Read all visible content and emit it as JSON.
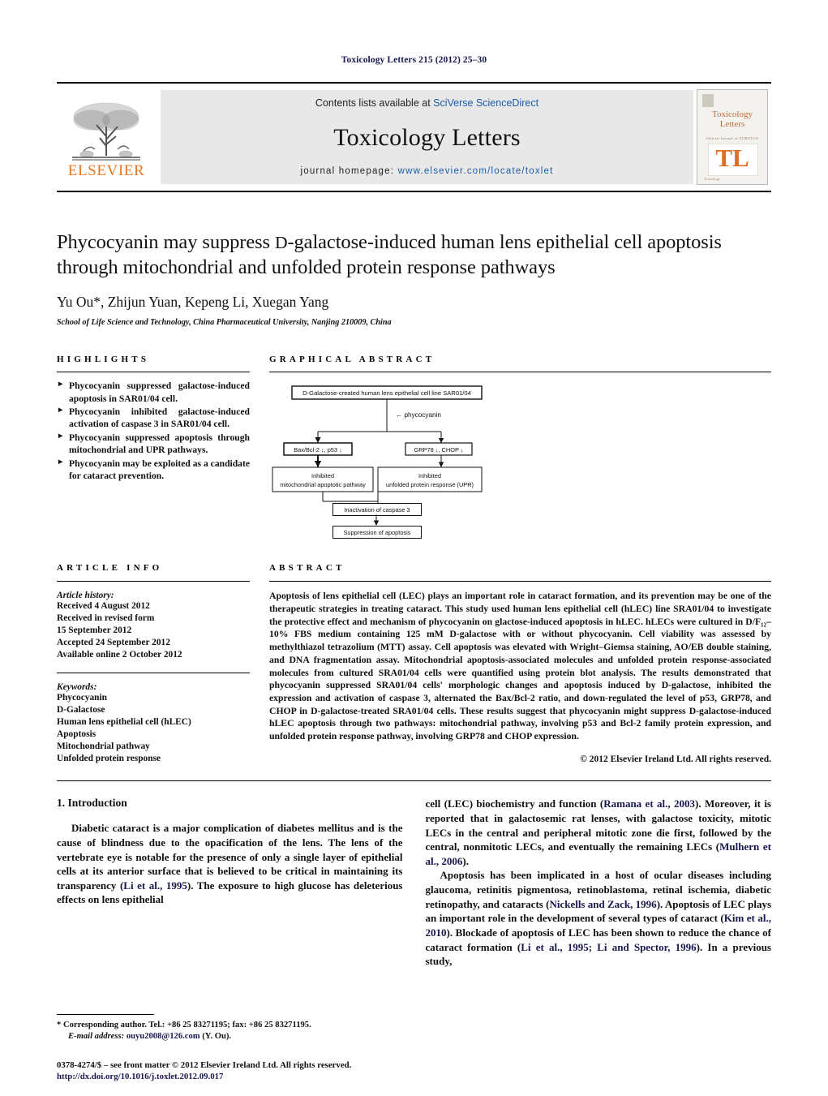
{
  "running_head": "Toxicology Letters 215 (2012) 25–30",
  "masthead": {
    "publisher": "ELSEVIER",
    "contents_prefix": "Contents lists available at ",
    "contents_link": "SciVerse ScienceDirect",
    "journal_title": "Toxicology Letters",
    "homepage_label": "journal homepage:",
    "homepage_url": "www.elsevier.com/locate/toxlet",
    "cover": {
      "title_line1": "Toxicology",
      "title_line2": "Letters",
      "subtitle": "Official Journal of EUROTOX",
      "monogram": "TL",
      "footer": "Toxicology"
    }
  },
  "article": {
    "title_line1_a": "Phycocyanin may suppress ",
    "title_line1_sc": "D",
    "title_line1_b": "-galactose-induced human lens epithelial cell",
    "title_line2": "apoptosis through mitochondrial and unfolded protein response pathways",
    "authors": "Yu Ou*, Zhijun Yuan, Kepeng Li, Xuegan Yang",
    "affiliation": "School of Life Science and Technology, China Pharmaceutical University, Nanjing 210009, China"
  },
  "highlights": {
    "heading": "Highlights",
    "bullet_glyph": "►",
    "items": [
      "Phycocyanin suppressed galactose-induced apoptosis in SAR01/04 cell.",
      "Phycocyanin inhibited galactose-induced activation of caspase 3 in SAR01/04 cell.",
      "Phycocyanin suppressed apoptosis through mitochondrial and UPR pathways.",
      "Phycocyanin may be exploited as a candidate for cataract prevention."
    ]
  },
  "graphical_abstract": {
    "heading": "Graphical abstract",
    "nodes": {
      "top": "D-Galactose-created human lens epithelial cell line SAR01/04",
      "arrow_label": "← phycocyanin",
      "left_mid": "Bax/Bcl-2 ↓,   p53 ↓",
      "right_mid": "GRP78 ↓,   CHOP ↓",
      "left_box_line1": "Inhibited",
      "left_box_line2": "mitochondrial apoptotic pathway",
      "right_box_line1": "Inhibited",
      "right_box_line2": "unfolded protein response (UPR)",
      "caspase": "Inactivation of caspase 3",
      "suppression": "Suppression of apoptosis"
    }
  },
  "article_info": {
    "heading": "Article info",
    "history_label": "Article history:",
    "history": [
      "Received 4 August 2012",
      "Received in revised form",
      "15 September 2012",
      "Accepted 24 September 2012",
      "Available online 2 October 2012"
    ],
    "keywords_label": "Keywords:",
    "keywords": [
      "Phycocyanin",
      "D-Galactose",
      "Human lens epithelial cell (hLEC)",
      "Apoptosis",
      "Mitochondrial pathway",
      "Unfolded protein response"
    ]
  },
  "abstract": {
    "heading": "Abstract",
    "body": "Apoptosis of lens epithelial cell (LEC) plays an important role in cataract formation, and its prevention may be one of the therapeutic strategies in treating cataract. This study used human lens epithelial cell (hLEC) line SRA01/04 to investigate the protective effect and mechanism of phycocyanin on glactose-induced apoptosis in hLEC. hLECs were cultured in D/F₁₂–10% FBS medium containing 125 mM D-galactose with or without phycocyanin. Cell viability was assessed by methylthiazol tetrazolium (MTT) assay. Cell apoptosis was elevated with Wright–Giemsa staining, AO/EB double staining, and DNA fragmentation assay. Mitochondrial apoptosis-associated molecules and unfolded protein response-associated molecules from cultured SRA01/04 cells were quantified using protein blot analysis. The results demonstrated that phycocyanin suppressed SRA01/04 cells' morphologic changes and apoptosis induced by D-galactose, inhibited the expression and activation of caspase 3, alternated the Bax/Bcl-2 ratio, and down-regulated the level of p53, GRP78, and CHOP in D-galactose-treated SRA01/04 cells. These results suggest that phycocyanin might suppress D-galactose-induced hLEC apoptosis through two pathways: mitochondrial pathway, involving p53 and Bcl-2 family protein expression, and unfolded protein response pathway, involving GRP78 and CHOP expression.",
    "copyright": "© 2012 Elsevier Ireland Ltd. All rights reserved."
  },
  "introduction": {
    "heading": "1.  Introduction",
    "left_paragraph_1_a": "Diabetic cataract is a major complication of diabetes mellitus and is the cause of blindness due to the opacification of the lens. The lens of the vertebrate eye is notable for the presence of only a single layer of epithelial cells at its anterior surface that is believed to be critical in maintaining its transparency (",
    "left_cite_1": "Li et al., 1995",
    "left_paragraph_1_b": "). The exposure to high glucose has deleterious effects on lens epithelial",
    "right_paragraph_1_a": "cell (LEC) biochemistry and function (",
    "right_cite_1": "Ramana et al., 2003",
    "right_paragraph_1_b": "). Moreover, it is reported that in galactosemic rat lenses, with galactose toxicity, mitotic LECs in the central and peripheral mitotic zone die first, followed by the central, nonmitotic LECs, and eventually the remaining LECs (",
    "right_cite_2": "Mulhern et al., 2006",
    "right_paragraph_1_c": ").",
    "right_paragraph_2_a": "Apoptosis has been implicated in a host of ocular diseases including glaucoma, retinitis pigmentosa, retinoblastoma, retinal ischemia, diabetic retinopathy, and cataracts (",
    "right_cite_3": "Nickells and Zack, 1996",
    "right_paragraph_2_b": "). Apoptosis of LEC plays an important role in the development of several types of cataract (",
    "right_cite_4": "Kim et al., 2010",
    "right_paragraph_2_c": "). Blockade of apoptosis of LEC has been shown to reduce the chance of cataract formation (",
    "right_cite_5": "Li et al., 1995; Li and Spector, 1996",
    "right_paragraph_2_d": "). In a previous study,"
  },
  "footnotes": {
    "corresponding_marker": "*",
    "corresponding": " Corresponding author. Tel.: +86 25 83271195; fax: +86 25 83271195.",
    "email_label": "E-mail address:",
    "email": "ouyu2008@126.com",
    "email_suffix": " (Y. Ou)."
  },
  "footer": {
    "issn": "0378-4274/$ – see front matter © 2012 Elsevier Ireland Ltd. All rights reserved.",
    "doi": "http://dx.doi.org/10.1016/j.toxlet.2012.09.017"
  },
  "colors": {
    "link": "#1a5ca8",
    "cite": "#17184f",
    "elsevier_orange": "#e87722",
    "band_gray": "#e8e8e8"
  }
}
